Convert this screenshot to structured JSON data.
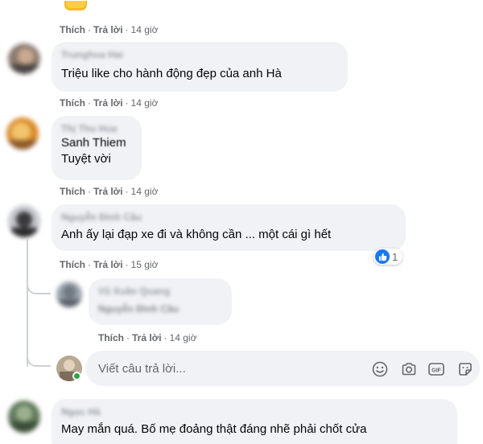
{
  "actions": {
    "like": "Thích",
    "reply": "Trả lời",
    "sep": "·"
  },
  "comments": [
    {
      "author": "Trunghoa Hai",
      "text": "",
      "time": "14 giờ"
    },
    {
      "author": "Trunghoa Hai",
      "text": "Triệu like cho hành động đẹp của anh Hà",
      "time": "14 giờ"
    },
    {
      "author": "Thị Thu Hoa",
      "tagged": "Sanh Thiem",
      "text": "Tuyệt vời",
      "time": "14 giờ"
    },
    {
      "author": "Nguyễn Đình Cầu",
      "text": "Anh ấy lại đạp xe đi và không cần ... một cái gì hết",
      "time": "15 giờ",
      "reaction_count": "1",
      "reply": {
        "author": "Vũ Xuân Quang",
        "tagged": "Nguyễn Đình Cầu",
        "time": "14 giờ"
      }
    },
    {
      "author": "Ngọc Hà",
      "text": "May mắn quá. Bố mẹ đoảng thật đáng nhẽ phải chốt cửa"
    }
  ],
  "reply_box": {
    "placeholder": "Viết câu trả lời..."
  },
  "icons": {
    "like_reaction": "thumbs-up-icon",
    "emoji": "smiley-icon",
    "camera": "camera-icon",
    "gif": "gif-icon",
    "sticker": "sticker-icon"
  },
  "colors": {
    "bubble": "#f0f2f5",
    "meta_text": "#65676b",
    "like_blue": "#1877f2",
    "online_green": "#31a24c"
  }
}
